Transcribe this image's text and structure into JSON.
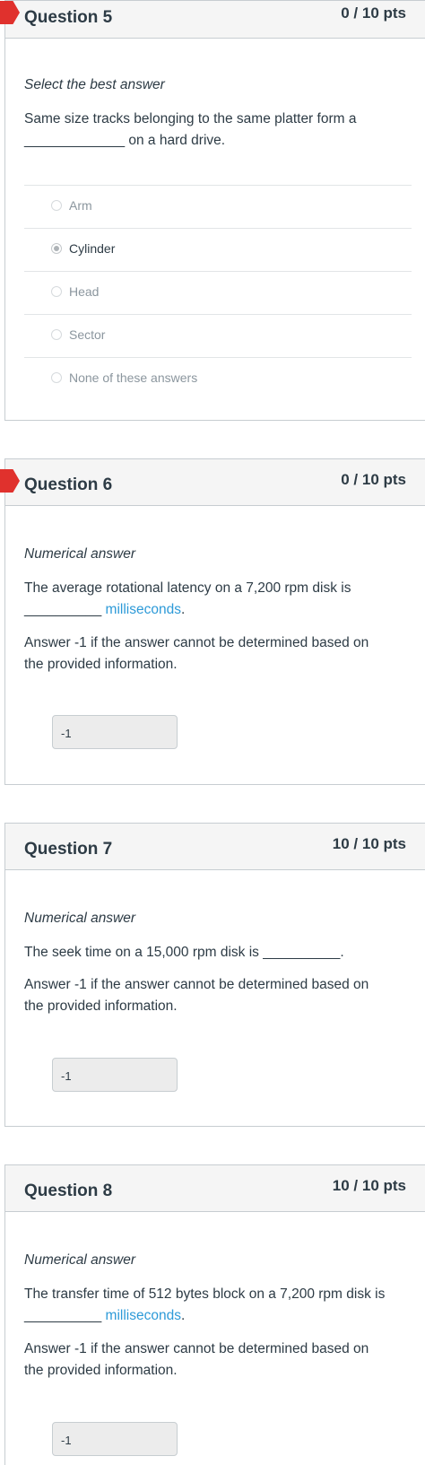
{
  "questions": [
    {
      "title": "Question 5",
      "points": "0 / 10 pts",
      "flagged": true,
      "type": "Select the best answer",
      "text_line1": "Same size tracks belonging to the same platter  form a",
      "text_line2": "_____________ on a hard drive.",
      "options": [
        {
          "label": "Arm",
          "selected": false
        },
        {
          "label": "Cylinder",
          "selected": true
        },
        {
          "label": "Head",
          "selected": false
        },
        {
          "label": "Sector",
          "selected": false
        },
        {
          "label": "None of these answers",
          "selected": false
        }
      ]
    },
    {
      "title": "Question 6",
      "points": "0 / 10 pts",
      "flagged": true,
      "type": "Numerical answer",
      "text_line1": "The average rotational latency on a 7,200 rpm disk is",
      "text_blank": "__________",
      "text_link": "milliseconds",
      "text_end": ".",
      "note_line1": "Answer -1 if the answer cannot be determined based on",
      "note_line2": "the provided information.",
      "answer_value": "-1"
    },
    {
      "title": "Question 7",
      "points": "10 / 10 pts",
      "flagged": false,
      "type": "Numerical answer",
      "text_line1": "The seek time on a 15,000 rpm disk is __________.",
      "note_line1": "Answer -1 if the answer cannot be determined based on",
      "note_line2": "the provided information.",
      "answer_value": "-1"
    },
    {
      "title": "Question 8",
      "points": "10 / 10 pts",
      "flagged": false,
      "type": "Numerical answer",
      "text_line1": "The transfer time of 512 bytes block on a 7,200 rpm disk is",
      "text_blank": "__________",
      "text_link": "milliseconds",
      "text_end": ".",
      "note_line1": "Answer -1 if the answer cannot be determined based on",
      "note_line2": "the provided information.",
      "answer_value": "-1"
    }
  ],
  "colors": {
    "flag": "#e0312d",
    "link": "#2d9ad8",
    "header_bg": "#f5f5f5",
    "border": "#c7cdd1"
  }
}
